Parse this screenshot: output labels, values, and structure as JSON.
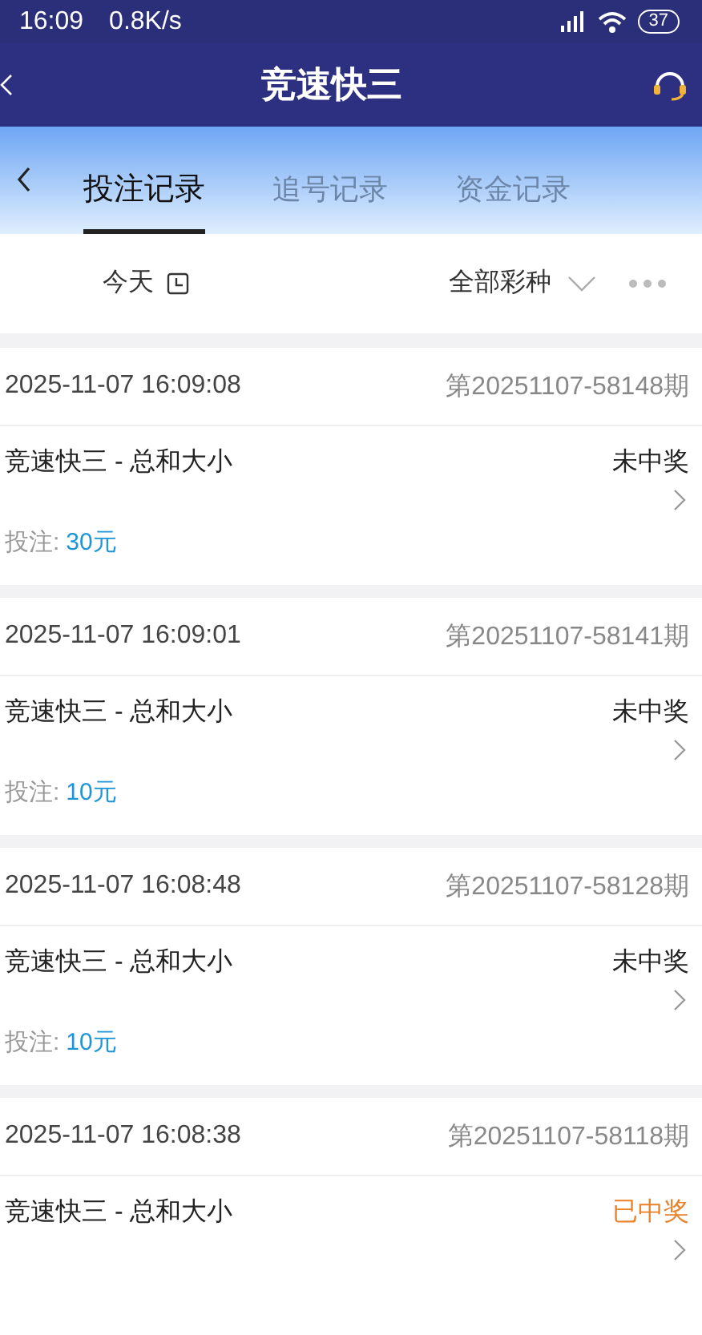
{
  "status_bar": {
    "time": "16:09",
    "speed": "0.8K/s",
    "battery": "37"
  },
  "header": {
    "title": "竞速快三"
  },
  "tabs": [
    {
      "label": "投注记录",
      "selected": true
    },
    {
      "label": "追号记录",
      "selected": false
    },
    {
      "label": "资金记录",
      "selected": false
    }
  ],
  "filters": {
    "date": "今天",
    "lottery": "全部彩种"
  },
  "records": [
    {
      "time": "2025-11-07 16:09:08",
      "issue": "第20251107-58148期",
      "game": "竞速快三 - 总和大小",
      "result": "未中奖",
      "won": false,
      "bet_label": "投注:",
      "bet": "30元"
    },
    {
      "time": "2025-11-07 16:09:01",
      "issue": "第20251107-58141期",
      "game": "竞速快三 - 总和大小",
      "result": "未中奖",
      "won": false,
      "bet_label": "投注:",
      "bet": "10元"
    },
    {
      "time": "2025-11-07 16:08:48",
      "issue": "第20251107-58128期",
      "game": "竞速快三 - 总和大小",
      "result": "未中奖",
      "won": false,
      "bet_label": "投注:",
      "bet": "10元"
    },
    {
      "time": "2025-11-07 16:08:38",
      "issue": "第20251107-58118期",
      "game": "竞速快三 - 总和大小",
      "result": "已中奖",
      "won": true
    }
  ]
}
